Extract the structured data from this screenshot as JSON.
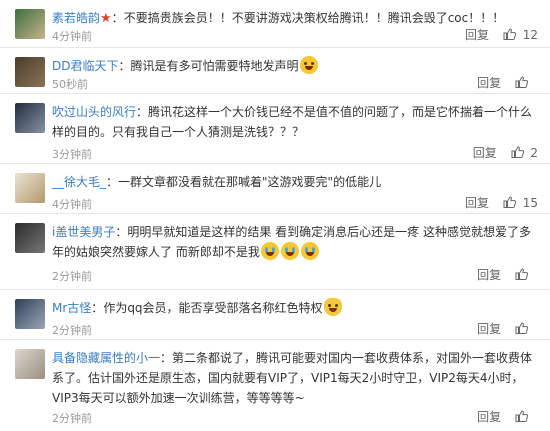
{
  "comments": [
    {
      "user": "素若皓韵",
      "badge": "★",
      "separator": "：",
      "text": "不要搞贵族会员！！不要讲游戏决策权给腾讯！！腾讯会毁了coc！！！",
      "time": "4分钟前",
      "reply": "回复",
      "likes": "12",
      "avatar_colors": [
        "#3b6e3e",
        "#c7b48a"
      ]
    },
    {
      "user": "DD君临天下",
      "separator": "：",
      "text": "腾讯是有多可怕需要特地发声明",
      "time": "50秒前",
      "reply": "回复",
      "likes": "",
      "avatar_colors": [
        "#4a3d2c",
        "#8a7355"
      ]
    },
    {
      "user": "吹过山头的风行",
      "separator": "：",
      "text": "腾讯花这样一个大价钱已经不是值不值的问题了，而是它怀揣着一个什么样的目的。只有我自己一个人猜测是洗钱？？？",
      "time": "3分钟前",
      "reply": "回复",
      "likes": "2",
      "avatar_colors": [
        "#222b3a",
        "#8895a8"
      ]
    },
    {
      "user": "__徐大毛_",
      "separator": "：",
      "text": "一群文章都没看就在那喊着\"这游戏要完\"的低能儿",
      "time": "4分钟前",
      "reply": "回复",
      "likes": "15",
      "avatar_colors": [
        "#e9e3d5",
        "#b39a6b"
      ]
    },
    {
      "user": "i盖世美男子",
      "separator": "：",
      "text_a": "明明早就知道是这样的结果 看到确定消息后心还是一疼 这种感觉就想爱了多年的姑娘突然要嫁人了 而新郎却不是我",
      "time": "2分钟前",
      "reply": "回复",
      "likes": "",
      "avatar_colors": [
        "#2b2b2b",
        "#777777"
      ]
    },
    {
      "user": "Mr古怪",
      "separator": "：",
      "text": "作为qq会员，能否享受部落名称红色特权",
      "time": "2分钟前",
      "reply": "回复",
      "likes": "",
      "avatar_colors": [
        "#2f3f55",
        "#9aa7b8"
      ]
    },
    {
      "user": "具备隐藏属性的小一",
      "separator": "：",
      "text": "第二条都说了，腾讯可能要对国内一套收费体系，对国外一套收费体系了。估计国外还是原生态，国内就要有VIP了，VIP1每天2小时守卫，VIP2每天4小时，VIP3每天可以额外加速一次训练营，等等等等~",
      "time": "2分钟前",
      "reply": "回复",
      "likes": "",
      "avatar_colors": [
        "#dcd7cf",
        "#9a8f80"
      ]
    }
  ],
  "icons": {
    "like": "thumbs-up-icon",
    "laugh": "laugh-emoji-icon",
    "cry": "cry-emoji-icon",
    "cat": "cat-emoji-icon"
  },
  "colors": {
    "username": "#3a7dc1",
    "meta": "#999999",
    "divider": "#e6e6e6"
  }
}
